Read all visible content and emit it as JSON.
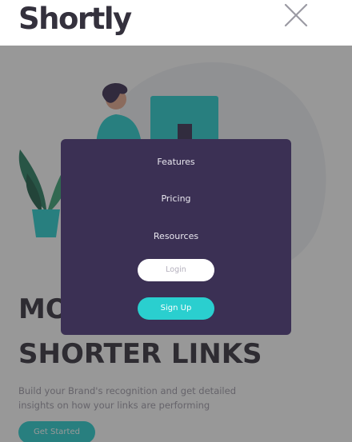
{
  "header": {
    "logo": "Shortly",
    "close_icon": "close-icon"
  },
  "hero": {
    "title_line1": "MORE THAN JUST",
    "title_line2": "SHORTER LINKS",
    "subtitle": "Build your Brand's recognition and get detailed insights on how your links are performing",
    "cta_label": "Get Started"
  },
  "menu": {
    "items": [
      {
        "label": "Features"
      },
      {
        "label": "Pricing"
      },
      {
        "label": "Resources"
      }
    ],
    "login_label": "Login",
    "signup_label": "Sign Up"
  },
  "colors": {
    "brand_text": "#34313d",
    "menu_bg": "#3b3054",
    "accent": "#2acfcf",
    "overlay": "rgba(40,40,40,0.48)"
  }
}
